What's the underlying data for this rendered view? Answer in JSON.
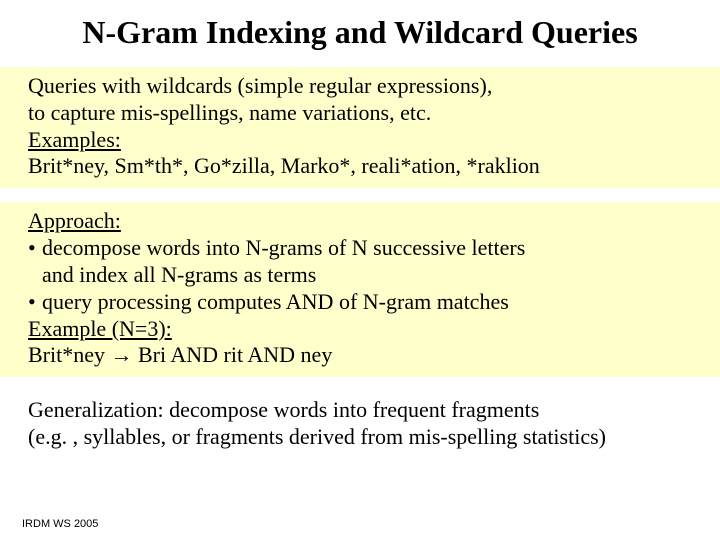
{
  "title": "N-Gram Indexing and Wildcard Queries",
  "block1": {
    "line1": "Queries with wildcards (simple regular expressions),",
    "line2": "to capture mis-spellings, name variations, etc.",
    "examples_label": "Examples:",
    "examples": "Brit*ney, Sm*th*, Go*zilla, Marko*, reali*ation, *raklion"
  },
  "block2": {
    "approach_label": "Approach:",
    "b1a": "decompose words into N-grams of N successive letters",
    "b1b": "and index all N-grams as terms",
    "b2": "query processing computes AND of N-gram matches",
    "example_label": "Example (N=3):",
    "example_lhs": "Brit*ney ",
    "arrow": "→",
    "example_rhs": " Bri AND rit AND ney"
  },
  "generalization": {
    "line1": "Generalization: decompose words into frequent fragments",
    "line2": "(e.g. , syllables, or fragments derived from mis-spelling statistics)"
  },
  "footer": "IRDM  WS 2005"
}
